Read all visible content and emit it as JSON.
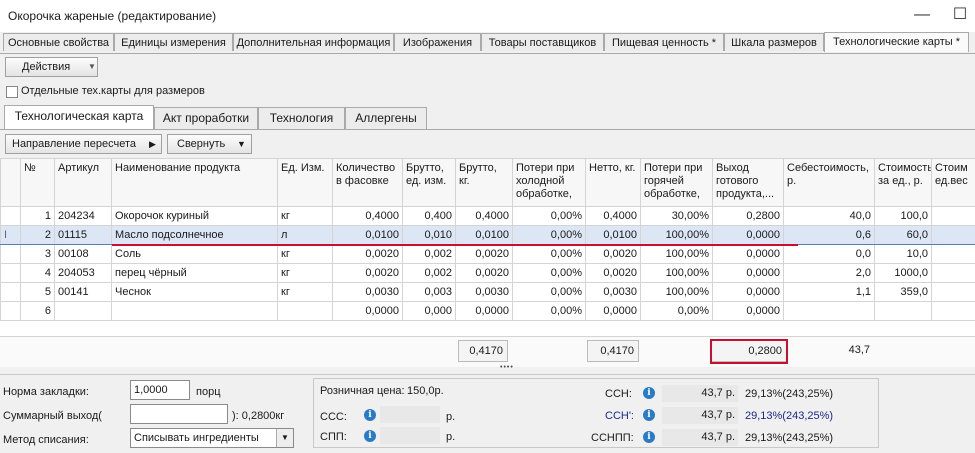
{
  "window": {
    "title": "Окорочка жареные  (редактирование)"
  },
  "main_tabs": [
    "Основные свойства",
    "Единицы измерения",
    "Дополнительная информация",
    "Изображения",
    "Товары поставщиков",
    "Пищевая ценность *",
    "Шкала размеров",
    "Технологические карты *"
  ],
  "toolbar": {
    "actions_label": "Действия",
    "separate_cards_label": "Отдельные тех.карты для размеров"
  },
  "sub_tabs": [
    "Технологическая карта",
    "Акт проработки",
    "Технология",
    "Аллергены"
  ],
  "buttons": {
    "recalc_label": "Направление пересчета",
    "collapse_label": "Свернуть"
  },
  "table": {
    "headers": [
      "№",
      "Артикул",
      "Наименование продукта",
      "Ед. Изм.",
      "Количество в фасовке",
      "Брутто, ед. изм.",
      "Брутто, кг.",
      "Потери при холодной обработке,",
      "Нетто, кг.",
      "Потери при горячей обработке,",
      "Выход готового продукта,...",
      "Себестоимость, р.",
      "Стоимость за ед., р.",
      "Стоим ед.вес"
    ],
    "rows": [
      [
        "1",
        "204234",
        "Окорочок куриный",
        "кг",
        "0,4000",
        "0,400",
        "0,4000",
        "0,00%",
        "0,4000",
        "30,00%",
        "0,2800",
        "40,0",
        "100,0",
        ""
      ],
      [
        "2",
        "01115",
        "Масло подсолнечное",
        "л",
        "0,0100",
        "0,010",
        "0,0100",
        "0,00%",
        "0,0100",
        "100,00%",
        "0,0000",
        "0,6",
        "60,0",
        ""
      ],
      [
        "3",
        "00108",
        "Соль",
        "кг",
        "0,0020",
        "0,002",
        "0,0020",
        "0,00%",
        "0,0020",
        "100,00%",
        "0,0000",
        "0,0",
        "10,0",
        ""
      ],
      [
        "4",
        "204053",
        "перец чёрный",
        "кг",
        "0,0020",
        "0,002",
        "0,0020",
        "0,00%",
        "0,0020",
        "100,00%",
        "0,0000",
        "2,0",
        "1000,0",
        ""
      ],
      [
        "5",
        "00141",
        "Чеснок",
        "кг",
        "0,0030",
        "0,003",
        "0,0030",
        "0,00%",
        "0,0030",
        "100,00%",
        "0,0000",
        "1,1",
        "359,0",
        ""
      ],
      [
        "6",
        "",
        "",
        "",
        "0,0000",
        "0,000",
        "0,0000",
        "0,00%",
        "0,0000",
        "0,00%",
        "0,0000",
        "",
        "",
        ""
      ]
    ],
    "row_marker": "I",
    "totals": {
      "brutto_kg": "0,4170",
      "netto_kg": "0,4170",
      "output": "0,2800",
      "cost": "43,7"
    }
  },
  "splitter": "••••",
  "bottom": {
    "norm_label": "Норма закладки:",
    "norm_value": "1,0000",
    "norm_unit": "порц",
    "total_output_label": "Суммарный выход(",
    "total_output_value": "",
    "total_output_suffix": "): 0,2800кг",
    "write_off_label": "Метод списания:",
    "write_off_value": "Списывать ингредиенты",
    "retail_price_label": "Розничная цена:",
    "retail_price_value": "150,0р.",
    "ccc_label": "ССС:",
    "ccc_unit": "р.",
    "cpp_label": "СПП:",
    "cpp_unit": "р.",
    "csn_label": "ССН:",
    "csn_value": "43,7 р.",
    "csn_pct": "29,13%(243,25%)",
    "csn2_label": "ССН':",
    "csn2_value": "43,7 р.",
    "csn2_pct": "29,13%(243,25%)",
    "csnpp_label": "ССНПП:",
    "csnpp_value": "43,7 р.",
    "csnpp_pct": "29,13%(243,25%)"
  },
  "icons": {
    "info": "info-icon",
    "dropdown": "chevron-down-icon",
    "play": "play-icon"
  },
  "colors": {
    "highlight": "#c8102e",
    "selection": "#dce6f4",
    "info": "#2a7bc7"
  }
}
